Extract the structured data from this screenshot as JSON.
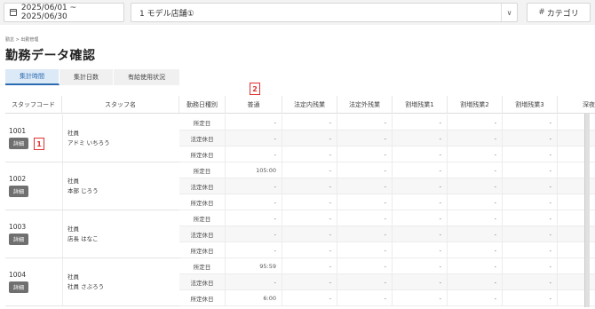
{
  "filter": {
    "date_range": "2025/06/01 ~ 2025/06/30",
    "store": "1 モデル店舗①",
    "category": "カテゴリ"
  },
  "breadcrumb": "勤怠 > 出勤管理",
  "title": "勤務データ確認",
  "tabs": [
    "集計時間",
    "集計日数",
    "有給使用状況"
  ],
  "markers": [
    "1",
    "2"
  ],
  "columns": [
    "スタッフコード",
    "スタッフ名",
    "勤務日種別",
    "普通",
    "法定内残業",
    "法定外残業",
    "割増残業1",
    "割増残業2",
    "割増残業3",
    "深夜"
  ],
  "detail_label": "詳細",
  "employees": [
    {
      "code": "1001",
      "role": "社員",
      "name": "アドミ いちろう",
      "rows": [
        {
          "type": "所定日",
          "vals": [
            "-",
            "-",
            "-",
            "-",
            "-",
            "-"
          ]
        },
        {
          "type": "法定休日",
          "vals": [
            "-",
            "-",
            "-",
            "-",
            "-",
            "-"
          ]
        },
        {
          "type": "所定休日",
          "vals": [
            "-",
            "-",
            "-",
            "-",
            "-",
            "-"
          ]
        }
      ]
    },
    {
      "code": "1002",
      "role": "社員",
      "name": "本部 じろう",
      "rows": [
        {
          "type": "所定日",
          "vals": [
            "105:00",
            "-",
            "-",
            "-",
            "-",
            "-"
          ]
        },
        {
          "type": "法定休日",
          "vals": [
            "-",
            "-",
            "-",
            "-",
            "-",
            "-"
          ]
        },
        {
          "type": "所定休日",
          "vals": [
            "-",
            "-",
            "-",
            "-",
            "-",
            "-"
          ]
        }
      ]
    },
    {
      "code": "1003",
      "role": "社員",
      "name": "店長 はなこ",
      "rows": [
        {
          "type": "所定日",
          "vals": [
            "-",
            "-",
            "-",
            "-",
            "-",
            "-"
          ]
        },
        {
          "type": "法定休日",
          "vals": [
            "-",
            "-",
            "-",
            "-",
            "-",
            "-"
          ]
        },
        {
          "type": "所定休日",
          "vals": [
            "-",
            "-",
            "-",
            "-",
            "-",
            "-"
          ]
        }
      ]
    },
    {
      "code": "1004",
      "role": "社員",
      "name": "社員 さぶろう",
      "rows": [
        {
          "type": "所定日",
          "vals": [
            "95:59",
            "-",
            "-",
            "-",
            "-",
            "-"
          ]
        },
        {
          "type": "法定休日",
          "vals": [
            "-",
            "-",
            "-",
            "-",
            "-",
            "-"
          ]
        },
        {
          "type": "所定休日",
          "vals": [
            "6:00",
            "-",
            "-",
            "-",
            "-",
            "-"
          ]
        }
      ]
    }
  ]
}
